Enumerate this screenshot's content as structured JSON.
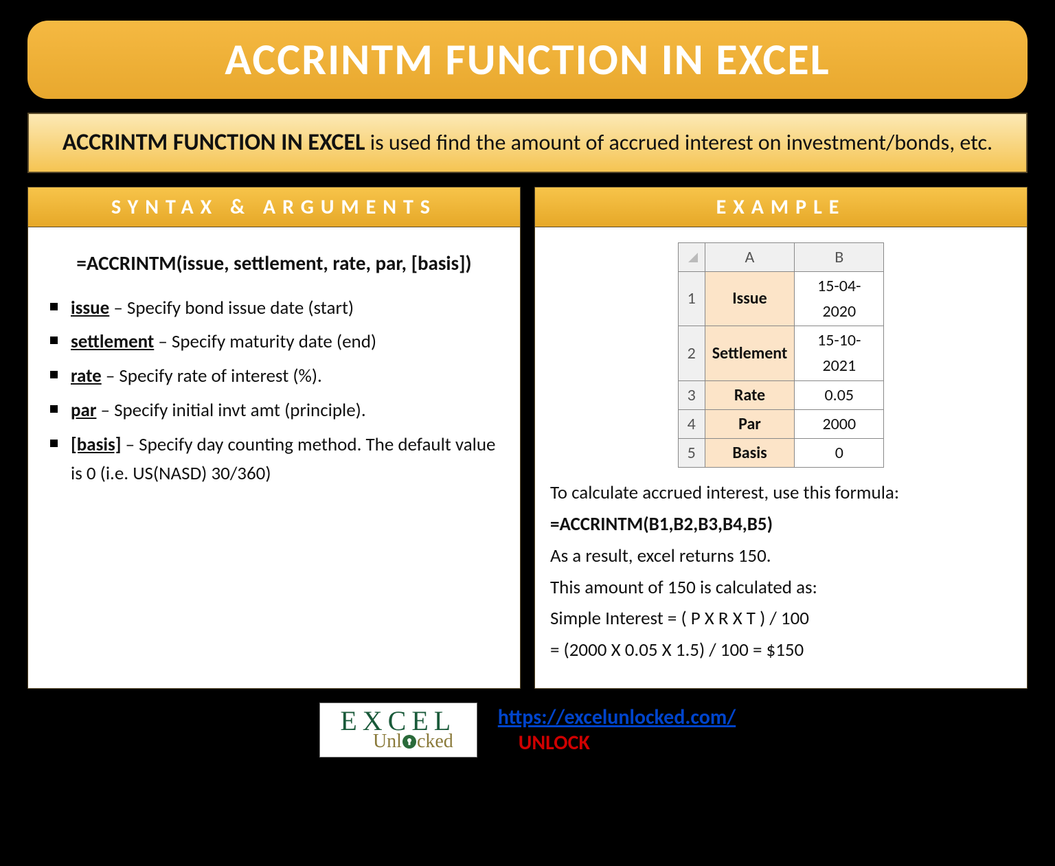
{
  "title": "ACCRINTM FUNCTION IN EXCEL",
  "description": {
    "lead": "ACCRINTM FUNCTION IN EXCEL",
    "rest": " is used find the amount of accrued interest on investment/bonds, etc."
  },
  "syntax": {
    "header": "SYNTAX & ARGUMENTS",
    "formula": "=ACCRINTM(issue, settlement, rate, par, [basis])",
    "args": [
      {
        "name": "issue",
        "desc": " – Specify bond issue date (start)"
      },
      {
        "name": "settlement",
        "desc": " – Specify maturity date (end)"
      },
      {
        "name": "rate",
        "desc": " – Specify rate of interest (%)."
      },
      {
        "name": "par",
        "desc": " – Specify initial invt amt (principle)."
      },
      {
        "name": "[basis]",
        "desc": " – Specify day counting method. The default value is 0 (i.e. US(NASD) 30/360)"
      }
    ]
  },
  "example": {
    "header": "EXAMPLE",
    "table": {
      "cols": [
        "A",
        "B"
      ],
      "rows": [
        {
          "n": "1",
          "label": "Issue",
          "value": "15-04-2020"
        },
        {
          "n": "2",
          "label": "Settlement",
          "value": "15-10-2021"
        },
        {
          "n": "3",
          "label": "Rate",
          "value": "0.05"
        },
        {
          "n": "4",
          "label": "Par",
          "value": "2000"
        },
        {
          "n": "5",
          "label": "Basis",
          "value": "0"
        }
      ]
    },
    "intro": "To calculate accrued interest, use this formula:",
    "formula": "=ACCRINTM(B1,B2,B3,B4,B5)",
    "result_line": "As a result, excel returns 150.",
    "calc_intro": "This amount of 150 is calculated as:",
    "calc_formula": "Simple Interest = ( P X R X T ) / 100",
    "calc_result": "= (2000 X 0.05 X 1.5) / 100 = $150"
  },
  "footer": {
    "logo_top": "EXCEL",
    "logo_bottom": "Unlocked",
    "url": "https://excelunlocked.com/",
    "unlock": "UNLOCK"
  }
}
